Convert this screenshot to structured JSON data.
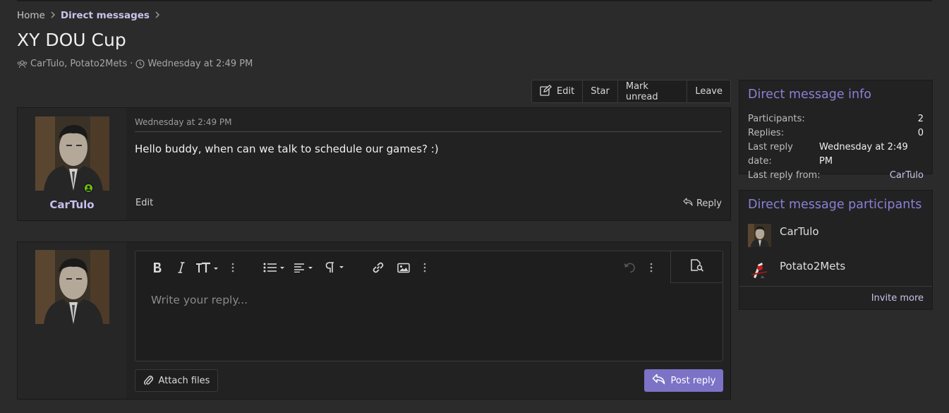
{
  "breadcrumb": {
    "home": "Home",
    "direct_messages": "Direct messages"
  },
  "page": {
    "title": "XY DOU Cup",
    "participants_text": "CarTulo, Potato2Mets",
    "separator": "·",
    "date": "Wednesday at 2:49 PM"
  },
  "actions": {
    "edit": "Edit",
    "star": "Star",
    "mark_unread": "Mark unread",
    "leave": "Leave"
  },
  "message": {
    "author": "CarTulo",
    "date": "Wednesday at 2:49 PM",
    "body": "Hello buddy, when can we talk to schedule our games? :)",
    "edit_label": "Edit",
    "reply_label": "Reply"
  },
  "reply_form": {
    "placeholder": "Write your reply...",
    "attach_label": "Attach files",
    "post_label": "Post reply"
  },
  "info_block": {
    "title": "Direct message info",
    "rows": [
      {
        "label": "Participants:",
        "value": "2"
      },
      {
        "label": "Replies:",
        "value": "0"
      },
      {
        "label": "Last reply date:",
        "value": "Wednesday at 2:49 PM"
      },
      {
        "label": "Last reply from:",
        "value": "CarTulo"
      }
    ]
  },
  "participants_block": {
    "title": "Direct message participants",
    "items": [
      {
        "name": "CarTulo"
      },
      {
        "name": "Potato2Mets"
      }
    ],
    "invite_label": "Invite more"
  },
  "colors": {
    "accent": "#7c72c6",
    "link": "#c9c3ea",
    "online": "#6bc20a",
    "background": "#2b2b2b"
  },
  "icons": [
    "chevron-right-icon",
    "users-icon",
    "clock-icon",
    "edit-icon",
    "user-icon",
    "reply-icon",
    "bold-icon",
    "italic-icon",
    "text-size-icon",
    "more-icon",
    "list-icon",
    "align-icon",
    "paragraph-icon",
    "link-icon",
    "image-icon",
    "undo-icon",
    "preview-icon",
    "paperclip-icon"
  ]
}
